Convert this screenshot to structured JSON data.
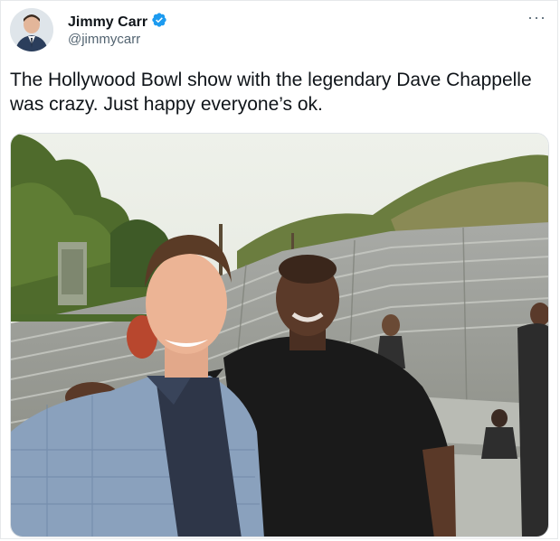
{
  "tweet": {
    "author_name": "Jimmy Carr",
    "handle": "@jimmycarr",
    "verified": true,
    "more_label": "···",
    "text": "The Hollywood Bowl show with the legendary Dave Chappelle was crazy. Just happy everyone’s ok.",
    "verified_icon": "verified-badge-icon",
    "colors": {
      "verified": "#1d9bf0",
      "muted": "#536471",
      "text": "#0f1419"
    }
  }
}
